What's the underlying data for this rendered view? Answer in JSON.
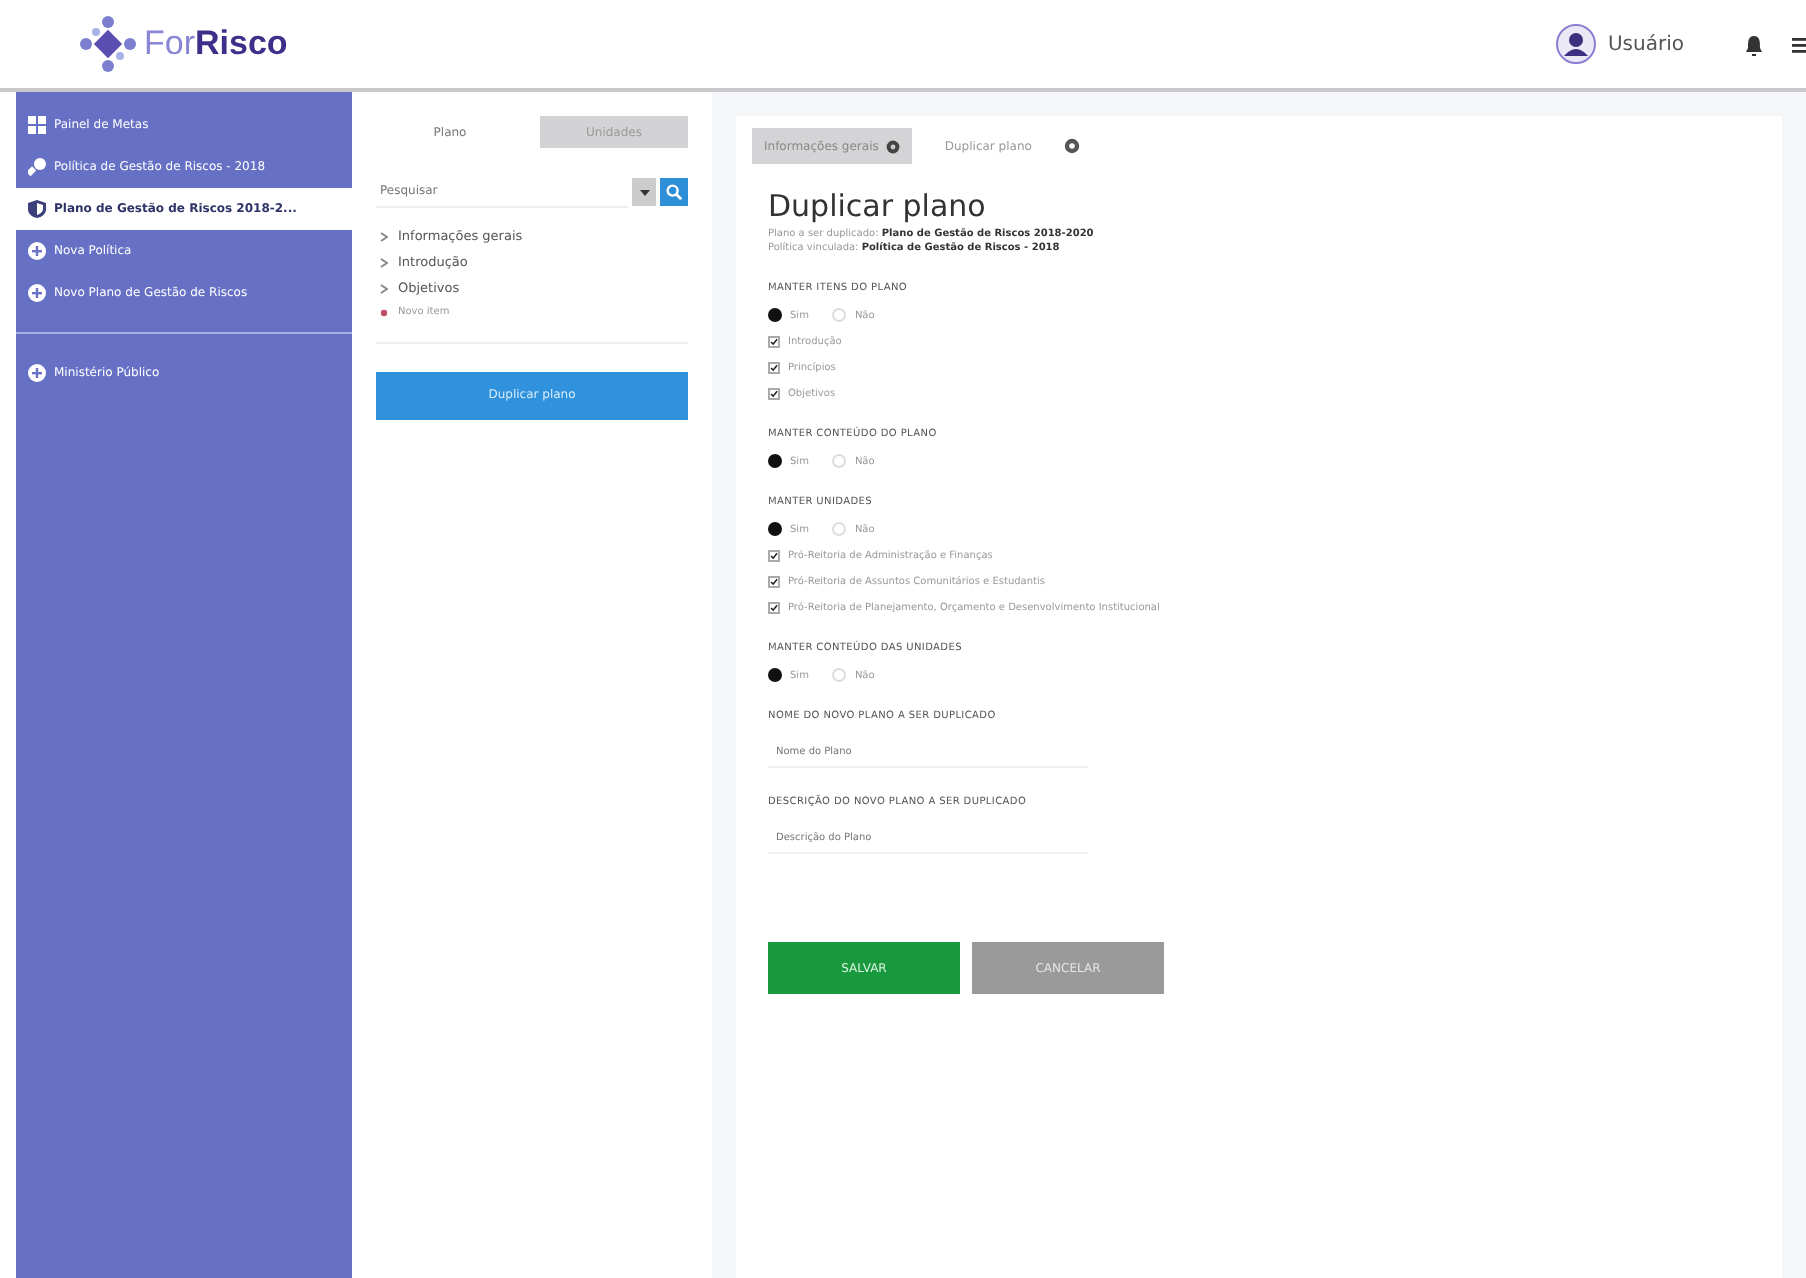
{
  "header": {
    "logo": "For**Risco**",
    "user": "Usuário"
  },
  "sidebar": {
    "items": [
      {
        "label": "Painel de Metas",
        "kind": "grid",
        "selected": false
      },
      {
        "label": "Política de Gestão de Riscos - 2018",
        "kind": "wrench",
        "selected": false
      },
      {
        "label": "Plano de Gestão de Riscos 2018-2...",
        "kind": "shield",
        "selected": true
      },
      {
        "label": "Nova Política",
        "kind": "plus",
        "selected": false
      },
      {
        "label": "Novo Plano de Gestão de Riscos",
        "kind": "plus",
        "selected": false
      }
    ],
    "footer_items": [
      {
        "label": "Ministério Público",
        "kind": "plus",
        "selected": false
      }
    ]
  },
  "outline": {
    "tabs": [
      {
        "label": "Plano",
        "selected": true
      },
      {
        "label": "Unidades",
        "selected": false
      }
    ],
    "search": {
      "placeholder": "Pesquisar"
    },
    "items": [
      {
        "label": "Informações gerais",
        "kind": "section"
      },
      {
        "label": "Introdução",
        "kind": "section"
      },
      {
        "label": "Objetivos",
        "kind": "section"
      },
      {
        "label": "Novo item",
        "kind": "new"
      }
    ],
    "button": "Duplicar plano"
  },
  "main": {
    "tabs": [
      {
        "label": "Informações gerais",
        "selected": true
      },
      {
        "label": "Duplicar plano",
        "selected": false
      }
    ],
    "title": "Duplicar plano",
    "info": [
      "Plano a ser duplicado: **Plano de Gestão de Riscos 2018-2020**",
      "Política vinculada: **Política de Gestão de Riscos - 2018**"
    ],
    "sections": [
      {
        "kind": "radio",
        "label": "MANTER ITENS DO PLANO",
        "options": [
          {
            "label": "Sim",
            "selected": true
          },
          {
            "label": "Não",
            "selected": false
          }
        ],
        "checks": [
          {
            "label": "Introdução",
            "checked": true
          },
          {
            "label": "Princípios",
            "checked": true
          },
          {
            "label": "Objetivos",
            "checked": true
          }
        ]
      },
      {
        "kind": "radio",
        "label": "MANTER CONTEÚDO DO PLANO",
        "options": [
          {
            "label": "Sim",
            "selected": true
          },
          {
            "label": "Não",
            "selected": false
          }
        ]
      },
      {
        "kind": "radio",
        "label": "MANTER UNIDADES",
        "options": [
          {
            "label": "Sim",
            "selected": true
          },
          {
            "label": "Não",
            "selected": false
          }
        ],
        "checks": [
          {
            "label": "Pró-Reitoria de Administração e Finanças",
            "checked": true
          },
          {
            "label": "Pró-Reitoria de Assuntos Comunitários e Estudantis",
            "checked": true
          },
          {
            "label": "Pró-Reitoria de Planejamento, Orçamento e Desenvolvimento Institucional",
            "checked": true
          }
        ]
      },
      {
        "kind": "radio",
        "label": "MANTER CONTEÚDO DAS UNIDADES",
        "options": [
          {
            "label": "Sim",
            "selected": true
          },
          {
            "label": "Não",
            "selected": false
          }
        ]
      },
      {
        "kind": "field",
        "label": "NOME DO NOVO PLANO A SER DUPLICADO",
        "placeholder": "Nome do Plano"
      },
      {
        "kind": "field",
        "label": "DESCRIÇÃO DO NOVO PLANO A SER DUPLICADO",
        "placeholder": "Descrição do Plano"
      }
    ],
    "buttons": [
      {
        "label": "SALVAR",
        "kind": "primary"
      },
      {
        "label": "CANCELAR",
        "kind": "secondary"
      }
    ]
  }
}
